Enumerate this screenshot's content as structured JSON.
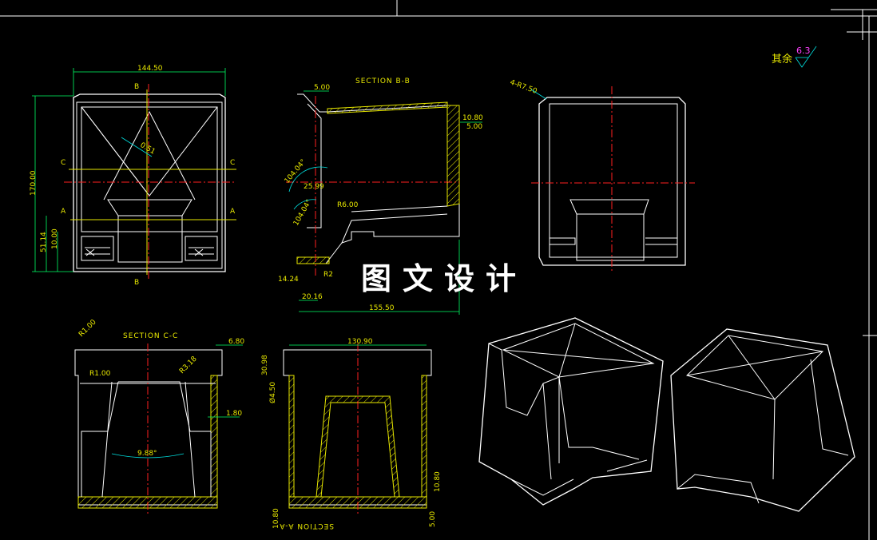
{
  "roughness": {
    "label": "其余",
    "value": "6.3"
  },
  "watermark": "图文设计",
  "sections": {
    "b": "SECTION B-B",
    "c": "SECTION C-C",
    "a": "SECTION A-A"
  },
  "markers": {
    "b_top": "B",
    "b_bottom": "B",
    "c_left": "C",
    "c_right": "C",
    "a_left": "A",
    "a_right": "A"
  },
  "dims": {
    "top_width": "144.50",
    "height": "170.00",
    "dim_51": "51.14",
    "dim_10": "10.00",
    "angle_051": "0.51",
    "b_500": "5.00",
    "b_1080": "10.80",
    "b_500b": "5.00",
    "b_angle1": "104.04°",
    "b_2599": "25.99",
    "b_r600": "R6.00",
    "b_angle2": "104.04°",
    "b_1424": "14.24",
    "b_r2": "R2",
    "b_2016": "20.16",
    "b_15550": "155.50",
    "r_corner": "4-R7.50",
    "c_r1": "R1.00",
    "c_r1b": "R1.00",
    "c_r3": "R3.18",
    "c_680": "6.80",
    "c_180": "1.80",
    "c_angle": "9.88°",
    "a_13090": "130.90",
    "a_3098": "30.98",
    "a_450": "Ø4.50",
    "a_1080": "10.80",
    "a_500": "5.00",
    "a_1080b": "10.80"
  }
}
